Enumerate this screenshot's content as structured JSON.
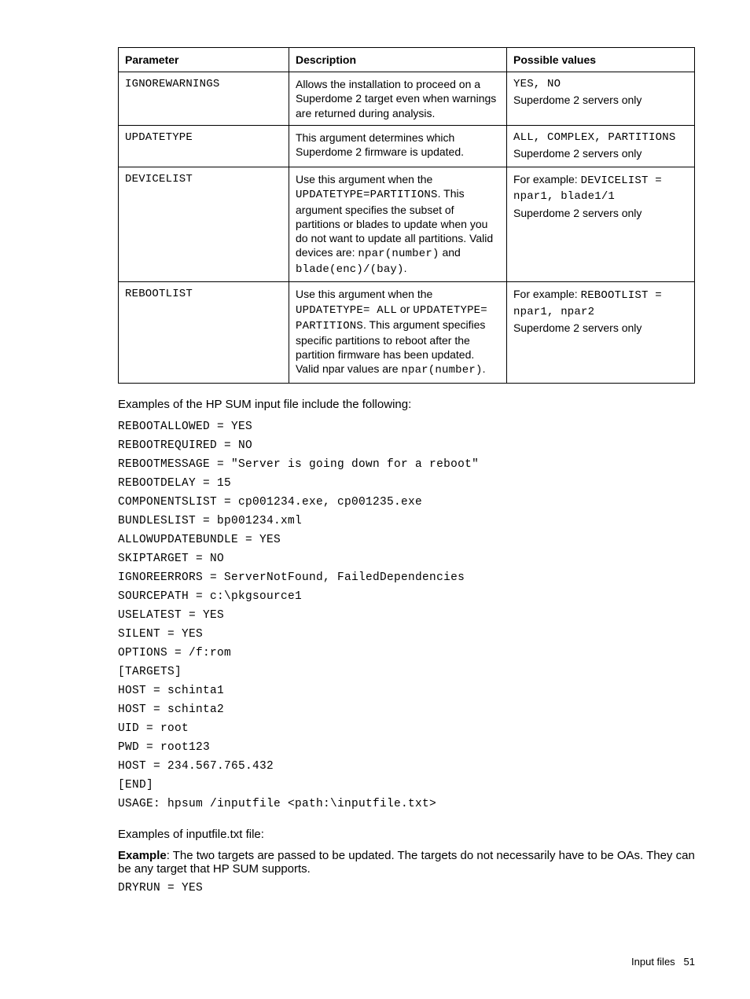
{
  "table": {
    "headers": [
      "Parameter",
      "Description",
      "Possible values"
    ],
    "rows": [
      {
        "param": "IGNOREWARNINGS",
        "desc_plain": "Allows the installation to proceed on a Superdome 2 target even when warnings are returned during analysis.",
        "pv_code": "YES, NO",
        "pv_text": "Superdome 2 servers only"
      },
      {
        "param": "UPDATETYPE",
        "desc_plain": "This argument determines which Superdome 2 firmware is updated.",
        "pv_code": "ALL, COMPLEX, PARTITIONS",
        "pv_text": "Superdome 2 servers only"
      },
      {
        "param": "DEVICELIST",
        "desc_text1": "Use this argument when the ",
        "desc_code1": "UPDATETYPE=PARTITIONS",
        "desc_text2": ". This argument specifies the subset of partitions or blades to update when you do not want to update all partitions. Valid devices are: ",
        "desc_code2": "npar(number)",
        "desc_text3": " and ",
        "desc_code3": "blade(enc)/(bay)",
        "desc_text4": ".",
        "pv_prefix": "For example: ",
        "pv_code": "DEVICELIST = npar1, blade1/1",
        "pv_text": "Superdome 2 servers only"
      },
      {
        "param": "REBOOTLIST",
        "desc_text1": "Use this argument when the ",
        "desc_code1": "UPDATETYPE= ALL",
        "desc_text2": " or ",
        "desc_code2": "UPDATETYPE= PARTITIONS",
        "desc_text3": ". This argument specifies specific partitions to reboot after the partition firmware has been updated. Valid npar values are ",
        "desc_code3": "npar(number)",
        "desc_text4": ".",
        "pv_prefix": "For example: ",
        "pv_code": "REBOOTLIST = npar1, npar2",
        "pv_text": "Superdome 2 servers only"
      }
    ]
  },
  "intro_text": "Examples of the HP SUM input file include the following:",
  "code_lines": [
    "REBOOTALLOWED = YES",
    "REBOOTREQUIRED = NO",
    "REBOOTMESSAGE = \"Server is going down for a reboot\"",
    "REBOOTDELAY = 15",
    "COMPONENTSLIST = cp001234.exe, cp001235.exe",
    "BUNDLESLIST = bp001234.xml",
    "ALLOWUPDATEBUNDLE = YES",
    "SKIPTARGET = NO",
    "IGNOREERRORS = ServerNotFound, FailedDependencies",
    "SOURCEPATH = c:\\pkgsource1",
    "USELATEST = YES",
    "SILENT = YES",
    "OPTIONS = /f:rom",
    "[TARGETS]",
    "HOST = schinta1",
    "HOST = schinta2",
    "UID = root",
    "PWD = root123",
    "HOST = 234.567.765.432",
    "[END]",
    "USAGE: hpsum /inputfile <path:\\inputfile.txt>"
  ],
  "examples_label": "Examples of inputfile.txt file:",
  "example_bold": "Example",
  "example_text": ": The two targets are passed to be updated. The targets do not necessarily have to be OAs. They can be any target that HP SUM supports.",
  "last_code": "DRYRUN = YES",
  "footer_label": "Input files",
  "footer_page": "51"
}
